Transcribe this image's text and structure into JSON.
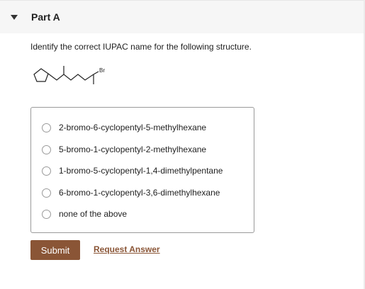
{
  "part": {
    "title": "Part A",
    "collapse_icon": "caret-down-icon"
  },
  "question": {
    "prompt": "Identify the correct IUPAC name for the following structure.",
    "structure_label": "Br"
  },
  "options": [
    {
      "label": "2-bromo-6-cyclopentyl-5-methylhexane",
      "selected": false
    },
    {
      "label": "5-bromo-1-cyclopentyl-2-methylhexane",
      "selected": false
    },
    {
      "label": "1-bromo-5-cyclopentyl-1,4-dimethylpentane",
      "selected": false
    },
    {
      "label": "6-bromo-1-cyclopentyl-3,6-dimethylhexane",
      "selected": false
    },
    {
      "label": "none of the above",
      "selected": false
    }
  ],
  "actions": {
    "submit_label": "Submit",
    "request_label": "Request Answer"
  },
  "colors": {
    "accent": "#8a5536",
    "header_bg": "#f6f6f6"
  }
}
